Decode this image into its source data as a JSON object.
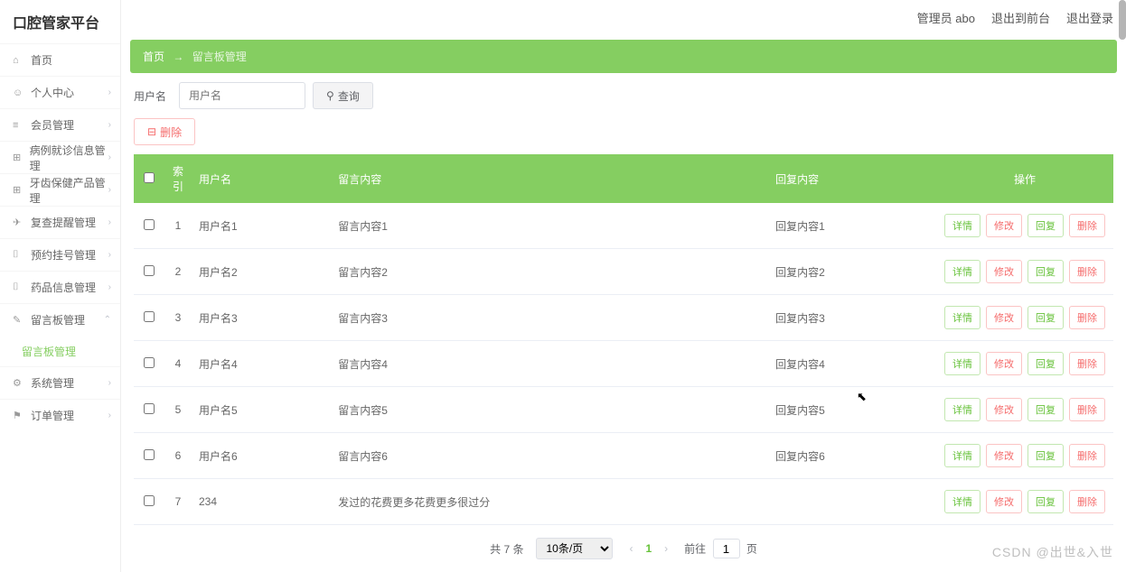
{
  "app": {
    "title": "口腔管家平台"
  },
  "topbar": {
    "admin": "管理员 abo",
    "to_front": "退出到前台",
    "logout": "退出登录"
  },
  "sidebar": {
    "items": [
      {
        "icon": "⌂",
        "label": "首页",
        "arrow": ""
      },
      {
        "icon": "☺",
        "label": "个人中心",
        "arrow": "›"
      },
      {
        "icon": "≡",
        "label": "会员管理",
        "arrow": "›"
      },
      {
        "icon": "⊞",
        "label": "病例就诊信息管理",
        "arrow": "›"
      },
      {
        "icon": "⊞",
        "label": "牙齿保健产品管理",
        "arrow": "›"
      },
      {
        "icon": "✈",
        "label": "复查提醒管理",
        "arrow": "›"
      },
      {
        "icon": "⌷",
        "label": "预约挂号管理",
        "arrow": "›"
      },
      {
        "icon": "⌷",
        "label": "药品信息管理",
        "arrow": "›"
      },
      {
        "icon": "✎",
        "label": "留言板管理",
        "arrow": "⌃"
      },
      {
        "icon": "⚙",
        "label": "系统管理",
        "arrow": "›"
      },
      {
        "icon": "⚑",
        "label": "订单管理",
        "arrow": "›"
      }
    ],
    "sub_active": "留言板管理"
  },
  "breadcrumb": {
    "home": "首页",
    "sep": "→",
    "current": "留言板管理"
  },
  "search": {
    "label": "用户名",
    "placeholder": "用户名",
    "query_btn": "查询",
    "icon": "⚲"
  },
  "toolbar": {
    "delete_btn": "删除",
    "del_icon": "⊟"
  },
  "table": {
    "headers": [
      "",
      "索引",
      "用户名",
      "留言内容",
      "回复内容",
      "操作"
    ],
    "rows": [
      {
        "idx": "1",
        "user": "用户名1",
        "msg": "留言内容1",
        "reply": "回复内容1"
      },
      {
        "idx": "2",
        "user": "用户名2",
        "msg": "留言内容2",
        "reply": "回复内容2"
      },
      {
        "idx": "3",
        "user": "用户名3",
        "msg": "留言内容3",
        "reply": "回复内容3"
      },
      {
        "idx": "4",
        "user": "用户名4",
        "msg": "留言内容4",
        "reply": "回复内容4"
      },
      {
        "idx": "5",
        "user": "用户名5",
        "msg": "留言内容5",
        "reply": "回复内容5"
      },
      {
        "idx": "6",
        "user": "用户名6",
        "msg": "留言内容6",
        "reply": "回复内容6"
      },
      {
        "idx": "7",
        "user": "234",
        "msg": "发过的花费更多花费更多很过分",
        "reply": ""
      }
    ],
    "ops": {
      "detail": "详情",
      "edit": "修改",
      "reply": "回复",
      "delete": "删除"
    }
  },
  "pagination": {
    "total_text": "共 7 条",
    "page_size": "10条/页",
    "current": "1",
    "goto_prefix": "前往",
    "goto_value": "1",
    "goto_suffix": "页"
  },
  "watermark": "CSDN @出世&入世"
}
